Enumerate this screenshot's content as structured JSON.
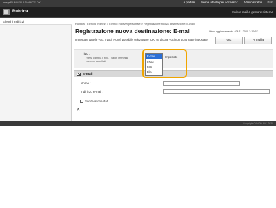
{
  "topbar": {
    "product": "imageRUNNER ADVANCE DX",
    "portal": "A portale",
    "login_user_label": "Nome utente per accesso :",
    "login_user_value": "Administrator",
    "logout": "Esci"
  },
  "app": {
    "title": "Rubrica",
    "send_link": "Invio e-mail a gestore sistema"
  },
  "sidebar": {
    "items": [
      {
        "label": "Elenchi indirizzi"
      }
    ]
  },
  "breadcrumb": "Rubrica : Elenchi indirizzi > Elenco indirizzi personale > Registrazione nuova destinazione: E-mail",
  "page": {
    "title": "Registrazione nuova destinazione: E-mail",
    "last_updated": "Ultimo aggiornamento : 04/11 2020 2:19:57",
    "message": "Impostare tutte le voci. I voci, Non è possibile selezionare [OK] se alcune voci non sono state impostate.",
    "ok_label": "OK",
    "cancel_label": "Annulla"
  },
  "type": {
    "label": "Tipo :",
    "note": "*Se si cambia il tipo, i valori immessi saranno annullati.",
    "options": [
      "E-mail",
      "I-Fax",
      "Fax",
      "File"
    ],
    "selected": "E-mail",
    "value_text": "Impostato"
  },
  "email_section": {
    "header": "E-mail",
    "name_label": "Nome :",
    "name_value": "",
    "address_label": "Indirizzo e-mail :",
    "address_value": "",
    "split_label": "Suddivisione dati",
    "split_checked": false
  },
  "footer": {
    "copyright": "Copyright CANON INC. 2020"
  }
}
